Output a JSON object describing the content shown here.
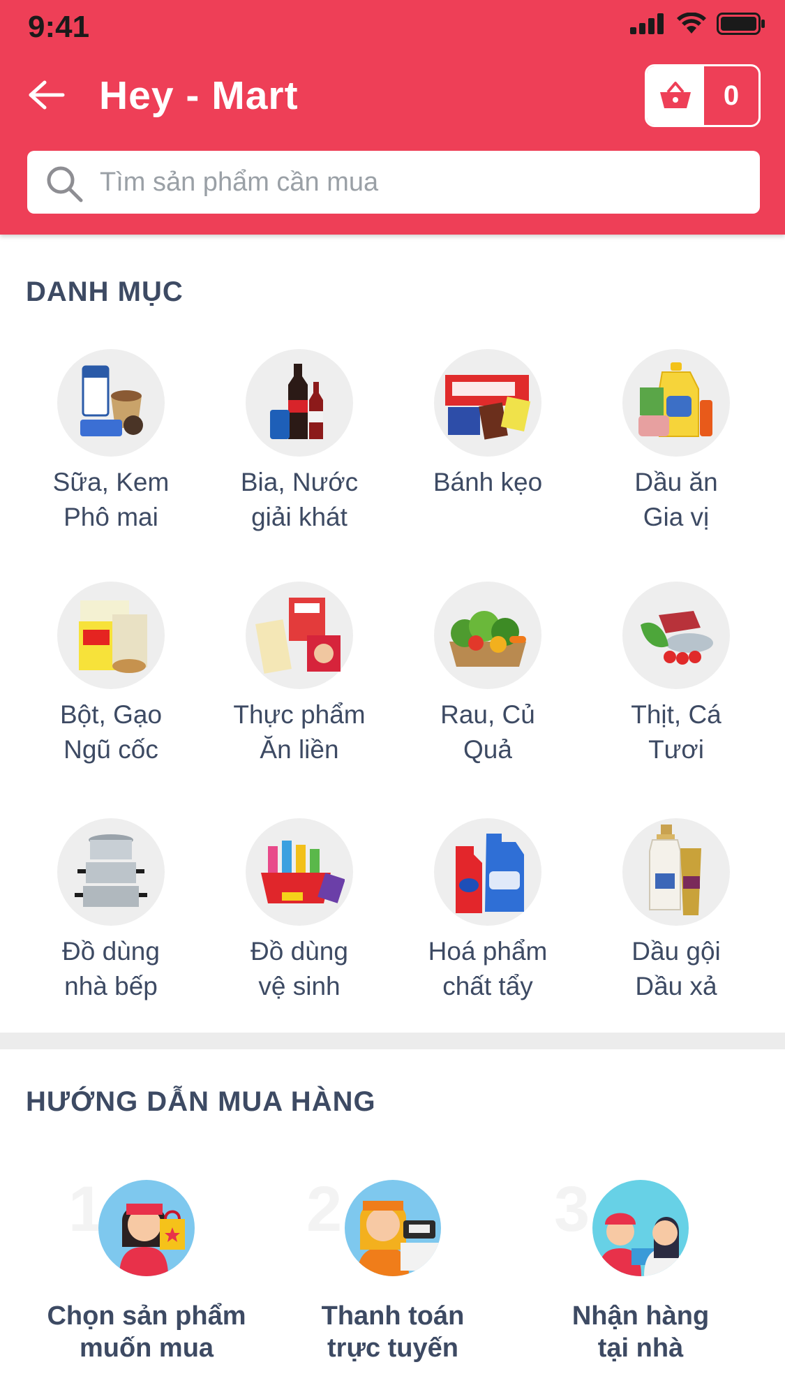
{
  "status_bar": {
    "time": "9:41"
  },
  "header": {
    "title": "Hey - Mart",
    "cart_count": "0"
  },
  "search": {
    "placeholder": "Tìm sản phẩm cần mua"
  },
  "categories_section": {
    "title": "DANH MỤC",
    "items": [
      {
        "line1": "Sữa, Kem",
        "line2": "Phô mai",
        "icon": "dairy-icon"
      },
      {
        "line1": "Bia, Nước",
        "line2": "giải khát",
        "icon": "drinks-icon"
      },
      {
        "line1": "Bánh kẹo",
        "line2": "",
        "icon": "snacks-icon"
      },
      {
        "line1": "Dầu ăn",
        "line2": "Gia vị",
        "icon": "oil-icon"
      },
      {
        "line1": "Bột, Gạo",
        "line2": "Ngũ cốc",
        "icon": "grain-icon"
      },
      {
        "line1": "Thực phẩm",
        "line2": "Ăn liền",
        "icon": "instant-food-icon"
      },
      {
        "line1": "Rau, Củ",
        "line2": "Quả",
        "icon": "vegetables-icon"
      },
      {
        "line1": "Thịt, Cá",
        "line2": "Tươi",
        "icon": "meat-fish-icon"
      },
      {
        "line1": "Đồ dùng",
        "line2": "nhà bếp",
        "icon": "pots-icon"
      },
      {
        "line1": "Đồ dùng",
        "line2": "vệ sinh",
        "icon": "cleaning-icon"
      },
      {
        "line1": "Hoá phẩm",
        "line2": "chất tẩy",
        "icon": "detergent-icon"
      },
      {
        "line1": "Dầu gội",
        "line2": "Dầu xả",
        "icon": "shampoo-icon"
      }
    ]
  },
  "guide_section": {
    "title": "HƯỚNG DẪN MUA HÀNG",
    "steps": [
      {
        "num": "1",
        "line1": "Chọn sản phẩm",
        "line2": "muốn mua"
      },
      {
        "num": "2",
        "line1": "Thanh toán",
        "line2": "trực tuyến"
      },
      {
        "num": "3",
        "line1": "Nhận hàng",
        "line2": "tại nhà"
      }
    ]
  },
  "colors": {
    "brand": "#ee3f57",
    "text": "#3d4a63",
    "divider": "#ececec"
  }
}
